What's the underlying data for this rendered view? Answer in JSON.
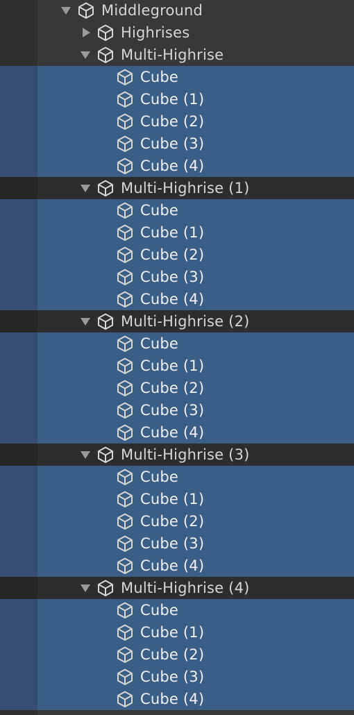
{
  "hierarchy": {
    "root": {
      "label": "Middleground"
    },
    "highrises": {
      "label": "Highrises"
    },
    "groups": [
      {
        "label": "Multi-Highrise",
        "children": [
          "Cube",
          "Cube (1)",
          "Cube (2)",
          "Cube (3)",
          "Cube (4)"
        ]
      },
      {
        "label": "Multi-Highrise (1)",
        "children": [
          "Cube",
          "Cube (1)",
          "Cube (2)",
          "Cube (3)",
          "Cube (4)"
        ]
      },
      {
        "label": "Multi-Highrise (2)",
        "children": [
          "Cube",
          "Cube (1)",
          "Cube (2)",
          "Cube (3)",
          "Cube (4)"
        ]
      },
      {
        "label": "Multi-Highrise (3)",
        "children": [
          "Cube",
          "Cube (1)",
          "Cube (2)",
          "Cube (3)",
          "Cube (4)"
        ]
      },
      {
        "label": "Multi-Highrise (4)",
        "children": [
          "Cube",
          "Cube (1)",
          "Cube (2)",
          "Cube (3)",
          "Cube (4)"
        ]
      }
    ]
  },
  "icons": {
    "cube": "cube-icon",
    "expanded": "triangle-down-icon",
    "collapsed": "triangle-right-icon"
  },
  "colors": {
    "background": "#383838",
    "selection": "#3a5f86",
    "text": "#d6d6d6"
  }
}
